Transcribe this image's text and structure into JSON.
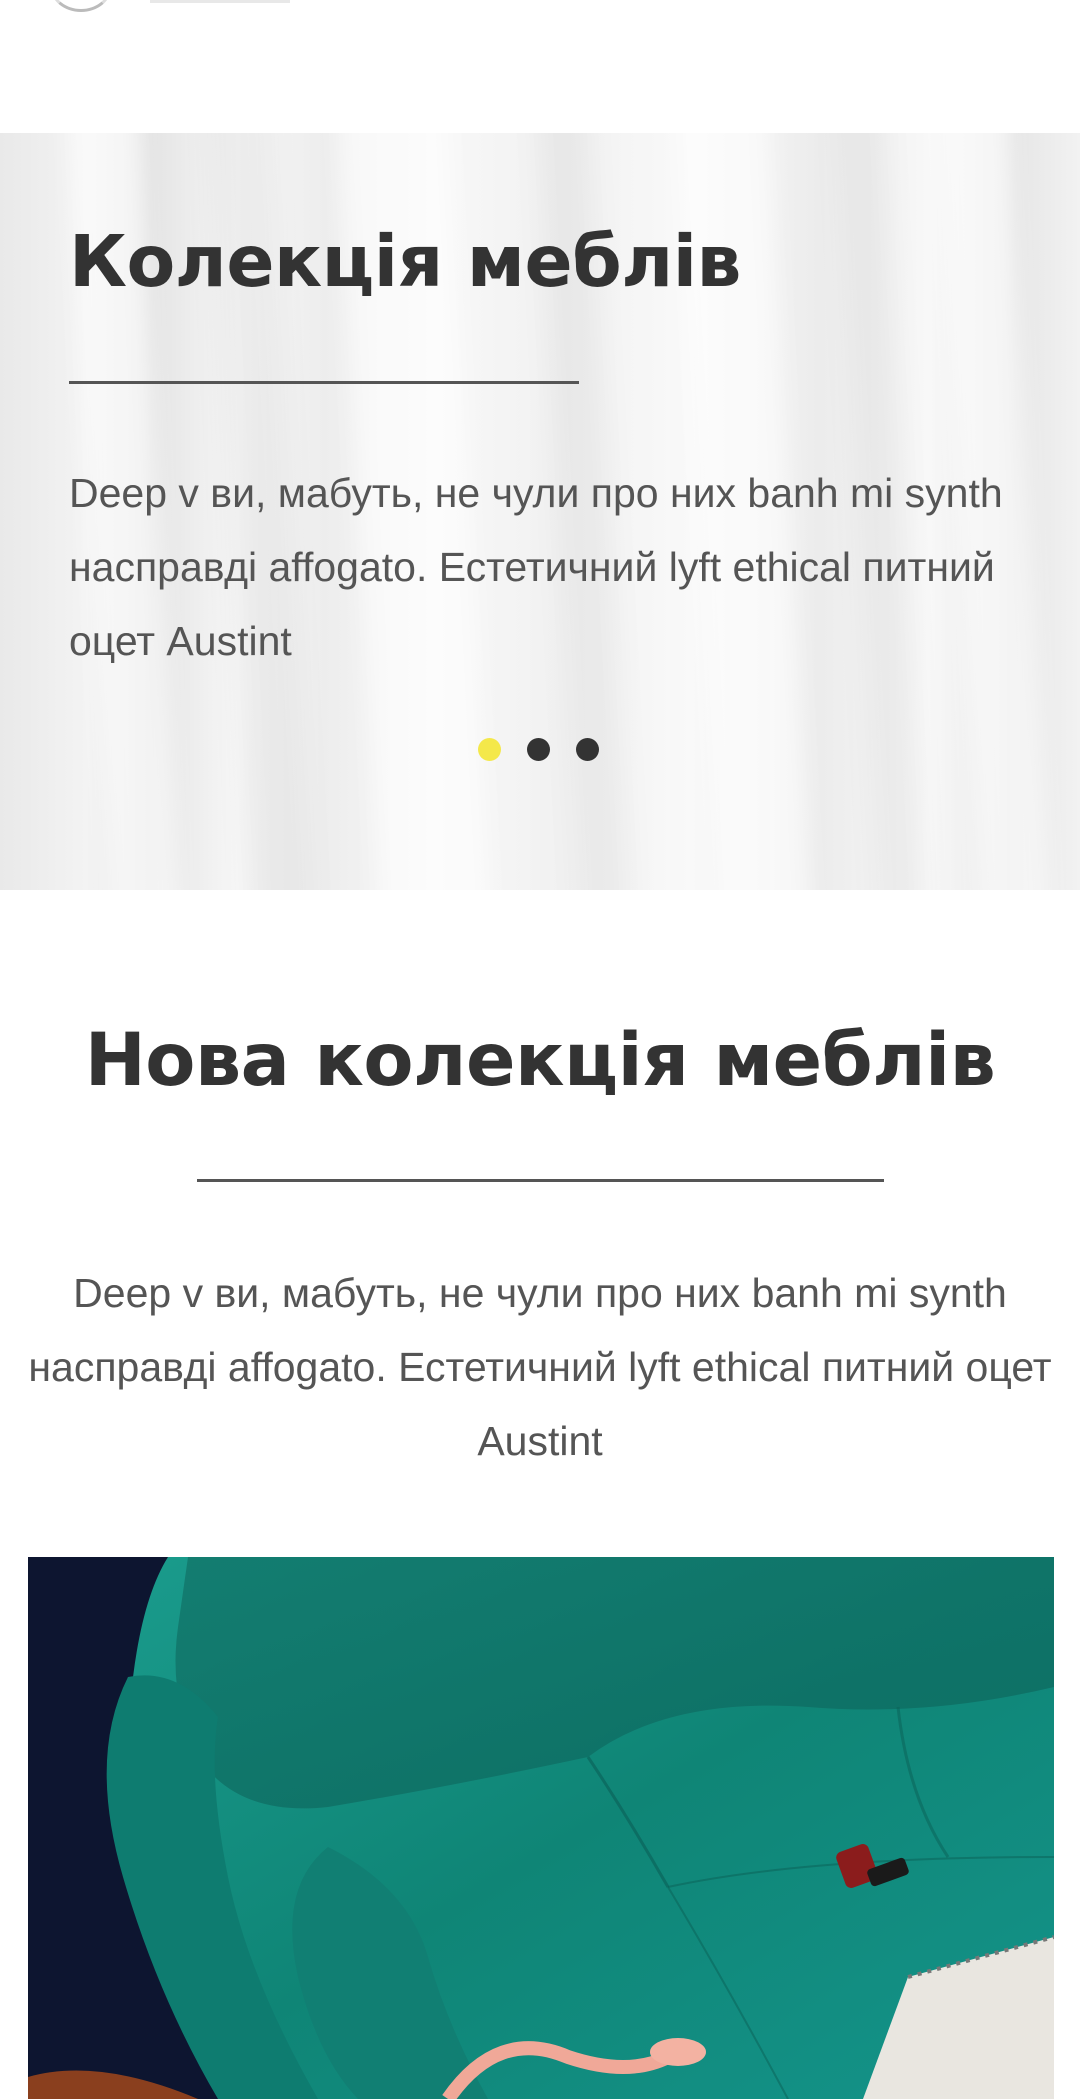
{
  "hero": {
    "title": "Колекція меблів",
    "text": "Deep v ви, мабуть, не чули про них banh mi synth насправді affogato. Естетичний lyft ethical питний оцет Austint",
    "slides_total": 3,
    "active_slide": 1
  },
  "collection": {
    "title": "Нова колекція меблів",
    "text": "Deep v ви, мабуть, не чули про них banh mi synth насправді affogato. Естетичний lyft ethical питний оцет Austint"
  },
  "colors": {
    "accent_dot": "#f4e84a",
    "dot": "#333333",
    "heading": "#333333",
    "body_text": "#555555",
    "sofa": "#0f8a7d",
    "photo_background": "#0d1530"
  }
}
